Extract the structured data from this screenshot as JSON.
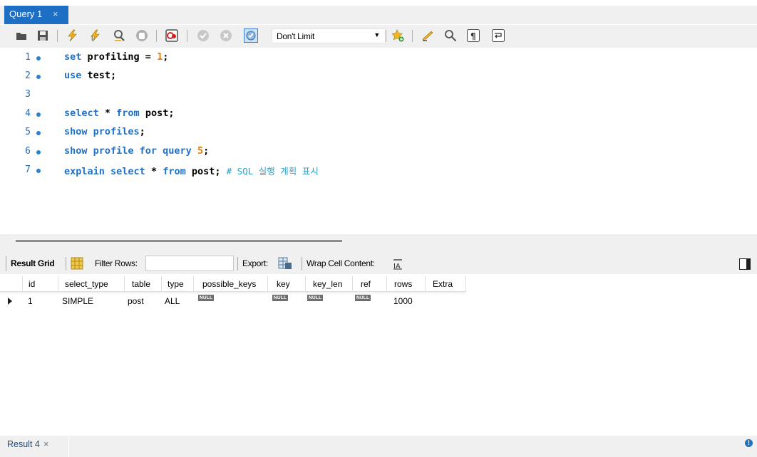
{
  "tabs": {
    "query_tab": "Query 1",
    "close": "×"
  },
  "toolbar": {
    "limit_value": "Don't Limit",
    "icons": [
      "open-folder-icon",
      "save-icon",
      "execute-icon",
      "execute-current-icon",
      "explain-icon",
      "stop-icon",
      "toggle-error-icon",
      "commit-icon",
      "rollback-icon",
      "autocommit-icon",
      "favorite-add-icon",
      "beautify-icon",
      "find-icon",
      "invisible-chars-icon",
      "wrap-icon"
    ]
  },
  "editor": {
    "lines": [
      {
        "num": "1",
        "dot": true
      },
      {
        "num": "2",
        "dot": true
      },
      {
        "num": "3",
        "dot": false
      },
      {
        "num": "4",
        "dot": true
      },
      {
        "num": "5",
        "dot": true
      },
      {
        "num": "6",
        "dot": true
      },
      {
        "num": "7",
        "dot": true
      }
    ],
    "code": {
      "l1_kw": "set",
      "l1_rest": " profiling = ",
      "l1_num": "1",
      "l1_end": ";",
      "l2_kw": "use",
      "l2_rest": " test;",
      "l4_kw1": "select",
      "l4_mid": " * ",
      "l4_kw2": "from",
      "l4_rest": " post;",
      "l5_kw": "show profiles",
      "l5_end": ";",
      "l6_kw": "show profile for query",
      "l6_sp": " ",
      "l6_num": "5",
      "l6_end": ";",
      "l7_kw1": "explain select",
      "l7_mid": " * ",
      "l7_kw2": "from",
      "l7_rest": " post; ",
      "l7_comment": "# SQL 실행 계획 표시"
    }
  },
  "results_toolbar": {
    "result_grid": "Result Grid",
    "filter_rows": "Filter Rows:",
    "export": "Export:",
    "wrap_cell": "Wrap Cell Content:"
  },
  "grid": {
    "headers": [
      "id",
      "select_type",
      "table",
      "type",
      "possible_keys",
      "key",
      "key_len",
      "ref",
      "rows",
      "Extra"
    ],
    "row": {
      "id": "1",
      "select_type": "SIMPLE",
      "table": "post",
      "type": "ALL",
      "possible_keys": "NULL",
      "key": "NULL",
      "key_len": "NULL",
      "ref": "NULL",
      "rows": "1000",
      "Extra": ""
    }
  },
  "bottom": {
    "result_tab": "Result 4",
    "close": "×"
  },
  "colors": {
    "accent": "#1c6fc3",
    "keyword": "#1f72c8",
    "number": "#e07b16",
    "comment": "#2aa3c9"
  }
}
